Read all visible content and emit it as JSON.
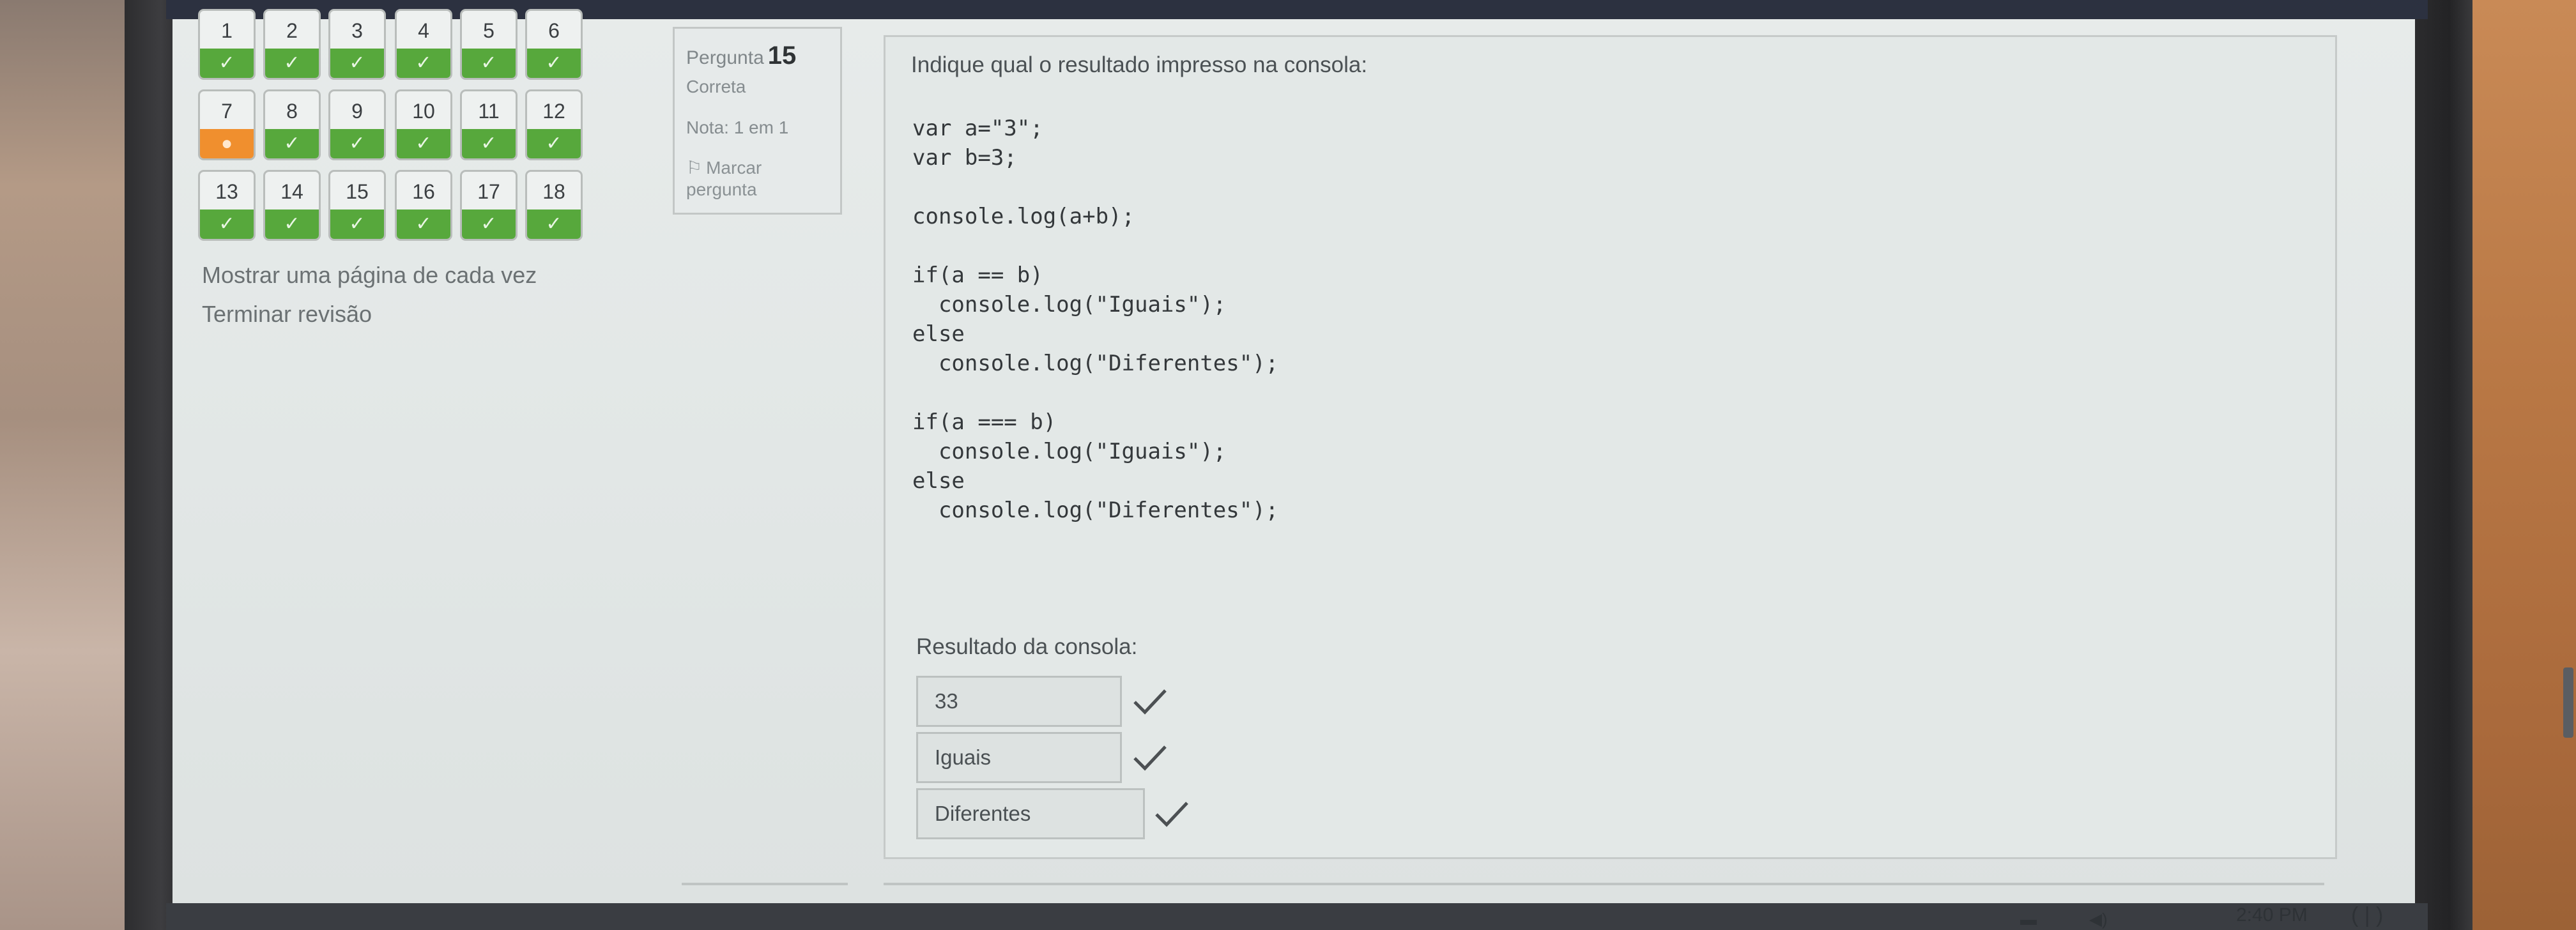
{
  "quiz_nav": {
    "questions": [
      {
        "num": "1",
        "state": "✓"
      },
      {
        "num": "2",
        "state": "✓"
      },
      {
        "num": "3",
        "state": "✓"
      },
      {
        "num": "4",
        "state": "✓"
      },
      {
        "num": "5",
        "state": "✓"
      },
      {
        "num": "6",
        "state": "✓"
      },
      {
        "num": "7",
        "state": "●"
      },
      {
        "num": "8",
        "state": "✓"
      },
      {
        "num": "9",
        "state": "✓"
      },
      {
        "num": "10",
        "state": "✓"
      },
      {
        "num": "11",
        "state": "✓"
      },
      {
        "num": "12",
        "state": "✓"
      },
      {
        "num": "13",
        "state": "✓"
      },
      {
        "num": "14",
        "state": "✓"
      },
      {
        "num": "15",
        "state": "✓"
      },
      {
        "num": "16",
        "state": "✓"
      },
      {
        "num": "17",
        "state": "✓"
      },
      {
        "num": "18",
        "state": "✓"
      }
    ],
    "show_one_page": "Mostrar uma página de cada vez",
    "finish_review": "Terminar revisão"
  },
  "info": {
    "question_label": "Pergunta",
    "question_number": "15",
    "state": "Correta",
    "grade": "Nota: 1 em 1",
    "flag_label": "Marcar pergunta",
    "flag_icon": "flag-icon"
  },
  "question": {
    "prompt": "Indique qual o resultado impresso na consola:",
    "code": "var a=\"3\";\nvar b=3;\n\nconsole.log(a+b);\n\nif(a == b)\n  console.log(\"Iguais\");\nelse\n  console.log(\"Diferentes\");\n\nif(a === b)\n  console.log(\"Iguais\");\nelse\n  console.log(\"Diferentes\");",
    "result_label": "Resultado da consola:",
    "answers": [
      "33",
      "Iguais",
      "Diferentes"
    ],
    "answer_status_icon": "check-icon"
  },
  "taskbar": {
    "time": "2:40 PM"
  },
  "colors": {
    "correct_green": "#57a83c",
    "pending_orange": "#f08f2e",
    "check_gray": "#4c5053"
  }
}
